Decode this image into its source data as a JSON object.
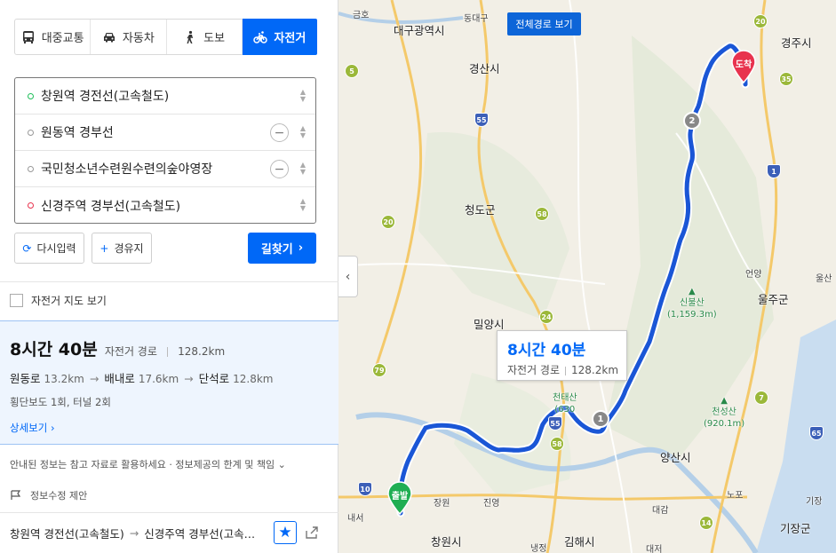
{
  "tabs": [
    {
      "label": "대중교통",
      "icon": "bus-icon"
    },
    {
      "label": "자동차",
      "icon": "car-icon"
    },
    {
      "label": "도보",
      "icon": "walk-icon"
    },
    {
      "label": "자전거",
      "icon": "bicycle-icon",
      "active": true
    }
  ],
  "waypoints": [
    {
      "label": "창원역 경전선(고속철도)",
      "type": "start"
    },
    {
      "label": "원동역 경부선",
      "type": "via"
    },
    {
      "label": "국민청소년수련원수련의숲야영장",
      "type": "via"
    },
    {
      "label": "신경주역 경부선(고속철도)",
      "type": "end"
    }
  ],
  "actions": {
    "reset": "다시입력",
    "add_waypoint": "경유지",
    "search": "길찾기"
  },
  "bike_map_label": "자전거 지도 보기",
  "result": {
    "time": "8시간 40분",
    "kind": "자전거 경로",
    "distance": "128.2km",
    "roads": [
      {
        "name": "원동로",
        "km": "13.2km"
      },
      {
        "name": "배내로",
        "km": "17.6km"
      },
      {
        "name": "단석로",
        "km": "12.8km"
      }
    ],
    "extra": "횡단보도 1회, 터널 2회",
    "detail_link": "상세보기"
  },
  "notice": "안내된 정보는 참고 자료로 활용하세요 · 정보제공의 한계 및 책임",
  "report": "정보수정 제안",
  "bottom_route": {
    "from": "창원역 경전선(고속철도)",
    "to": "신경주역 경부선(고속…"
  },
  "map": {
    "full_route_button": "전체경로 보기",
    "tooltip": {
      "time": "8시간 40분",
      "kind": "자전거 경로",
      "distance": "128.2km"
    },
    "start_label": "출발",
    "end_label": "도착",
    "waypoint_markers": [
      "1",
      "2"
    ],
    "cities": [
      "대구광역시",
      "경산시",
      "경주시",
      "청도군",
      "밀양시",
      "울주군",
      "양산시",
      "창원시",
      "김해시",
      "기장군"
    ],
    "small_labels": [
      "금호",
      "동대구",
      "언양",
      "울산",
      "진영",
      "대감",
      "노포",
      "기장",
      "내서",
      "장원",
      "대저",
      "냉정"
    ],
    "mountains": [
      {
        "name": "신불산",
        "height": "(1,159.3m)"
      },
      {
        "name": "천성산",
        "height": "(920.1m)"
      },
      {
        "name": "천태산",
        "height": "(630"
      }
    ],
    "road_numbers": [
      "20",
      "5",
      "35",
      "55",
      "1",
      "58",
      "20",
      "24",
      "79",
      "7",
      "55",
      "58",
      "10",
      "65",
      "14"
    ],
    "route_color": "#1a56d6"
  }
}
